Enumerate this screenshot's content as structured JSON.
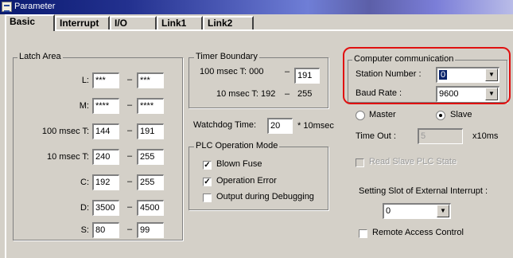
{
  "window": {
    "title": "Parameter"
  },
  "tabs": [
    {
      "label": "Basic"
    },
    {
      "label": "Interrupt"
    },
    {
      "label": "I/O"
    },
    {
      "label": "Link1"
    },
    {
      "label": "Link2"
    }
  ],
  "latch": {
    "title": "Latch Area",
    "dash": "–",
    "rows": [
      {
        "label": "L:",
        "from": "***",
        "to": "***"
      },
      {
        "label": "M:",
        "from": "****",
        "to": "****"
      },
      {
        "label": "100 msec T:",
        "from": "144",
        "to": "191"
      },
      {
        "label": "10 msec T:",
        "from": "240",
        "to": "255"
      },
      {
        "label": "C:",
        "from": "192",
        "to": "255"
      },
      {
        "label": "D:",
        "from": "3500",
        "to": "4500"
      },
      {
        "label": "S:",
        "from": "80",
        "to": "99"
      }
    ]
  },
  "timer": {
    "title": "Timer Boundary",
    "row1_label": "100 msec T: 000",
    "row1_dash": "–",
    "row1_value": "191",
    "row2_label": "10 msec T: 192",
    "row2_dash": "–",
    "row2_value": "255"
  },
  "watchdog": {
    "label": "Watchdog Time:",
    "value": "20",
    "unit": "* 10msec"
  },
  "plc_mode": {
    "title": "PLC Operation Mode",
    "options": [
      {
        "label": "Blown Fuse",
        "checked": true
      },
      {
        "label": "Operation Error",
        "checked": true
      },
      {
        "label": "Output during Debugging",
        "checked": false
      }
    ]
  },
  "comm": {
    "title": "Computer communication",
    "station_label": "Station Number :",
    "station_value": "0",
    "baud_label": "Baud Rate :",
    "baud_value": "9600",
    "master_label": "Master",
    "slave_label": "Slave",
    "selected_mode": "Slave",
    "timeout_label": "Time Out :",
    "timeout_value": "5",
    "timeout_unit": "x10ms",
    "read_slave_label": "Read Slave PLC State"
  },
  "ext_interrupt": {
    "label": "Setting Slot of External Interrupt :",
    "value": "0"
  },
  "remote": {
    "label": "Remote Access Control"
  },
  "colors": {
    "highlight": "#e01010",
    "selection": "#0a246a"
  }
}
